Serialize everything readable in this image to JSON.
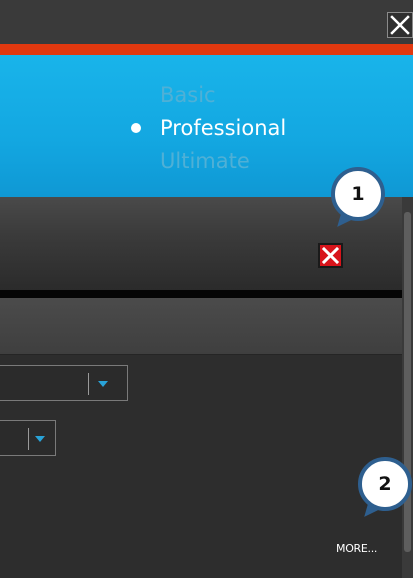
{
  "window": {
    "close_icon": "close-icon"
  },
  "edition_selector": {
    "options": [
      "Basic",
      "Professional",
      "Ultimate"
    ],
    "selected": "Professional"
  },
  "toolbar": {
    "close_icon": "close-icon"
  },
  "main": {
    "more_link": "MORE..."
  },
  "callouts": [
    {
      "label": "1"
    },
    {
      "label": "2"
    }
  ],
  "colors": {
    "accent": "#e1380f",
    "banner": "#13a7e1",
    "close_red": "#d8141b",
    "dropdown_arrow": "#29a3d8",
    "callout_border": "#2e5f8f"
  }
}
